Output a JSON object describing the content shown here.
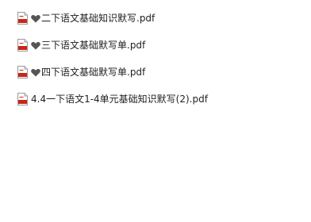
{
  "files": [
    {
      "icon": "pdf-file-icon",
      "badge": "heart-icon",
      "name": "二下语文基础知识默写.pdf"
    },
    {
      "icon": "pdf-file-icon",
      "badge": "heart-icon",
      "name": "三下语文基础默写单.pdf"
    },
    {
      "icon": "pdf-file-icon",
      "badge": "heart-icon",
      "name": "四下语文基础默写单.pdf"
    },
    {
      "icon": "pdf-file-icon",
      "badge": "",
      "name": "4.4一下语文1-4单元基础知识默写(2).pdf"
    }
  ],
  "colors": {
    "pdf_red": "#c8261a",
    "heart": "#555555",
    "text": "#1f1f1f"
  }
}
